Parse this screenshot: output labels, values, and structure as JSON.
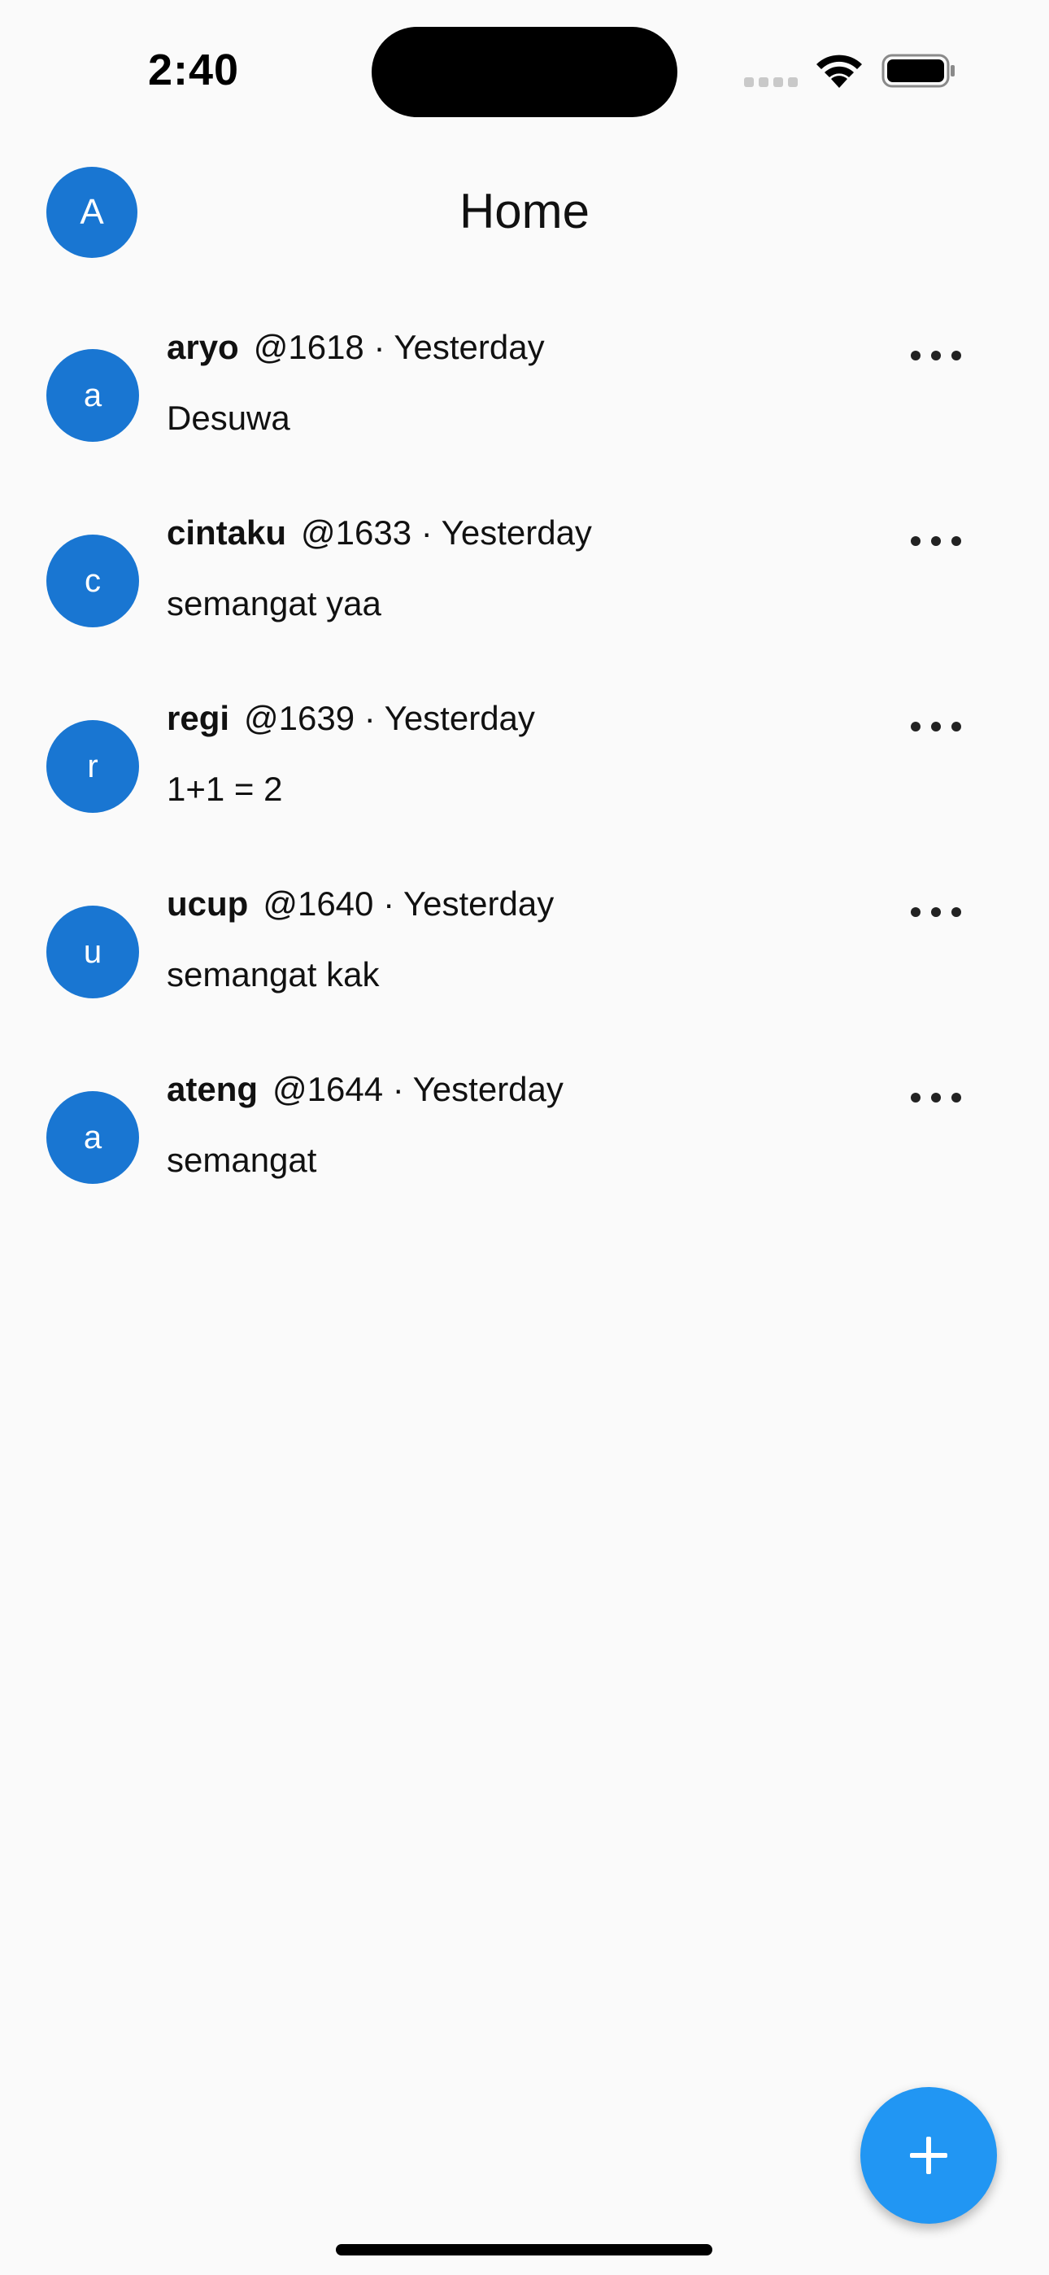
{
  "status_bar": {
    "time": "2:40"
  },
  "header": {
    "avatar_initial": "A",
    "title": "Home"
  },
  "posts": [
    {
      "avatar_initial": "a",
      "name": "aryo",
      "meta": "@1618 · Yesterday",
      "text": "Desuwa"
    },
    {
      "avatar_initial": "c",
      "name": "cintaku",
      "meta": "@1633 · Yesterday",
      "text": "semangat yaa"
    },
    {
      "avatar_initial": "r",
      "name": "regi",
      "meta": "@1639 · Yesterday",
      "text": "1+1 = 2"
    },
    {
      "avatar_initial": "u",
      "name": "ucup",
      "meta": "@1640 · Yesterday",
      "text": "semangat kak"
    },
    {
      "avatar_initial": "a",
      "name": "ateng",
      "meta": "@1644 · Yesterday",
      "text": "semangat"
    }
  ],
  "fab": {
    "icon": "plus-icon"
  },
  "colors": {
    "avatar": "#1976d2",
    "fab": "#2196f3",
    "background": "#fafafa"
  }
}
